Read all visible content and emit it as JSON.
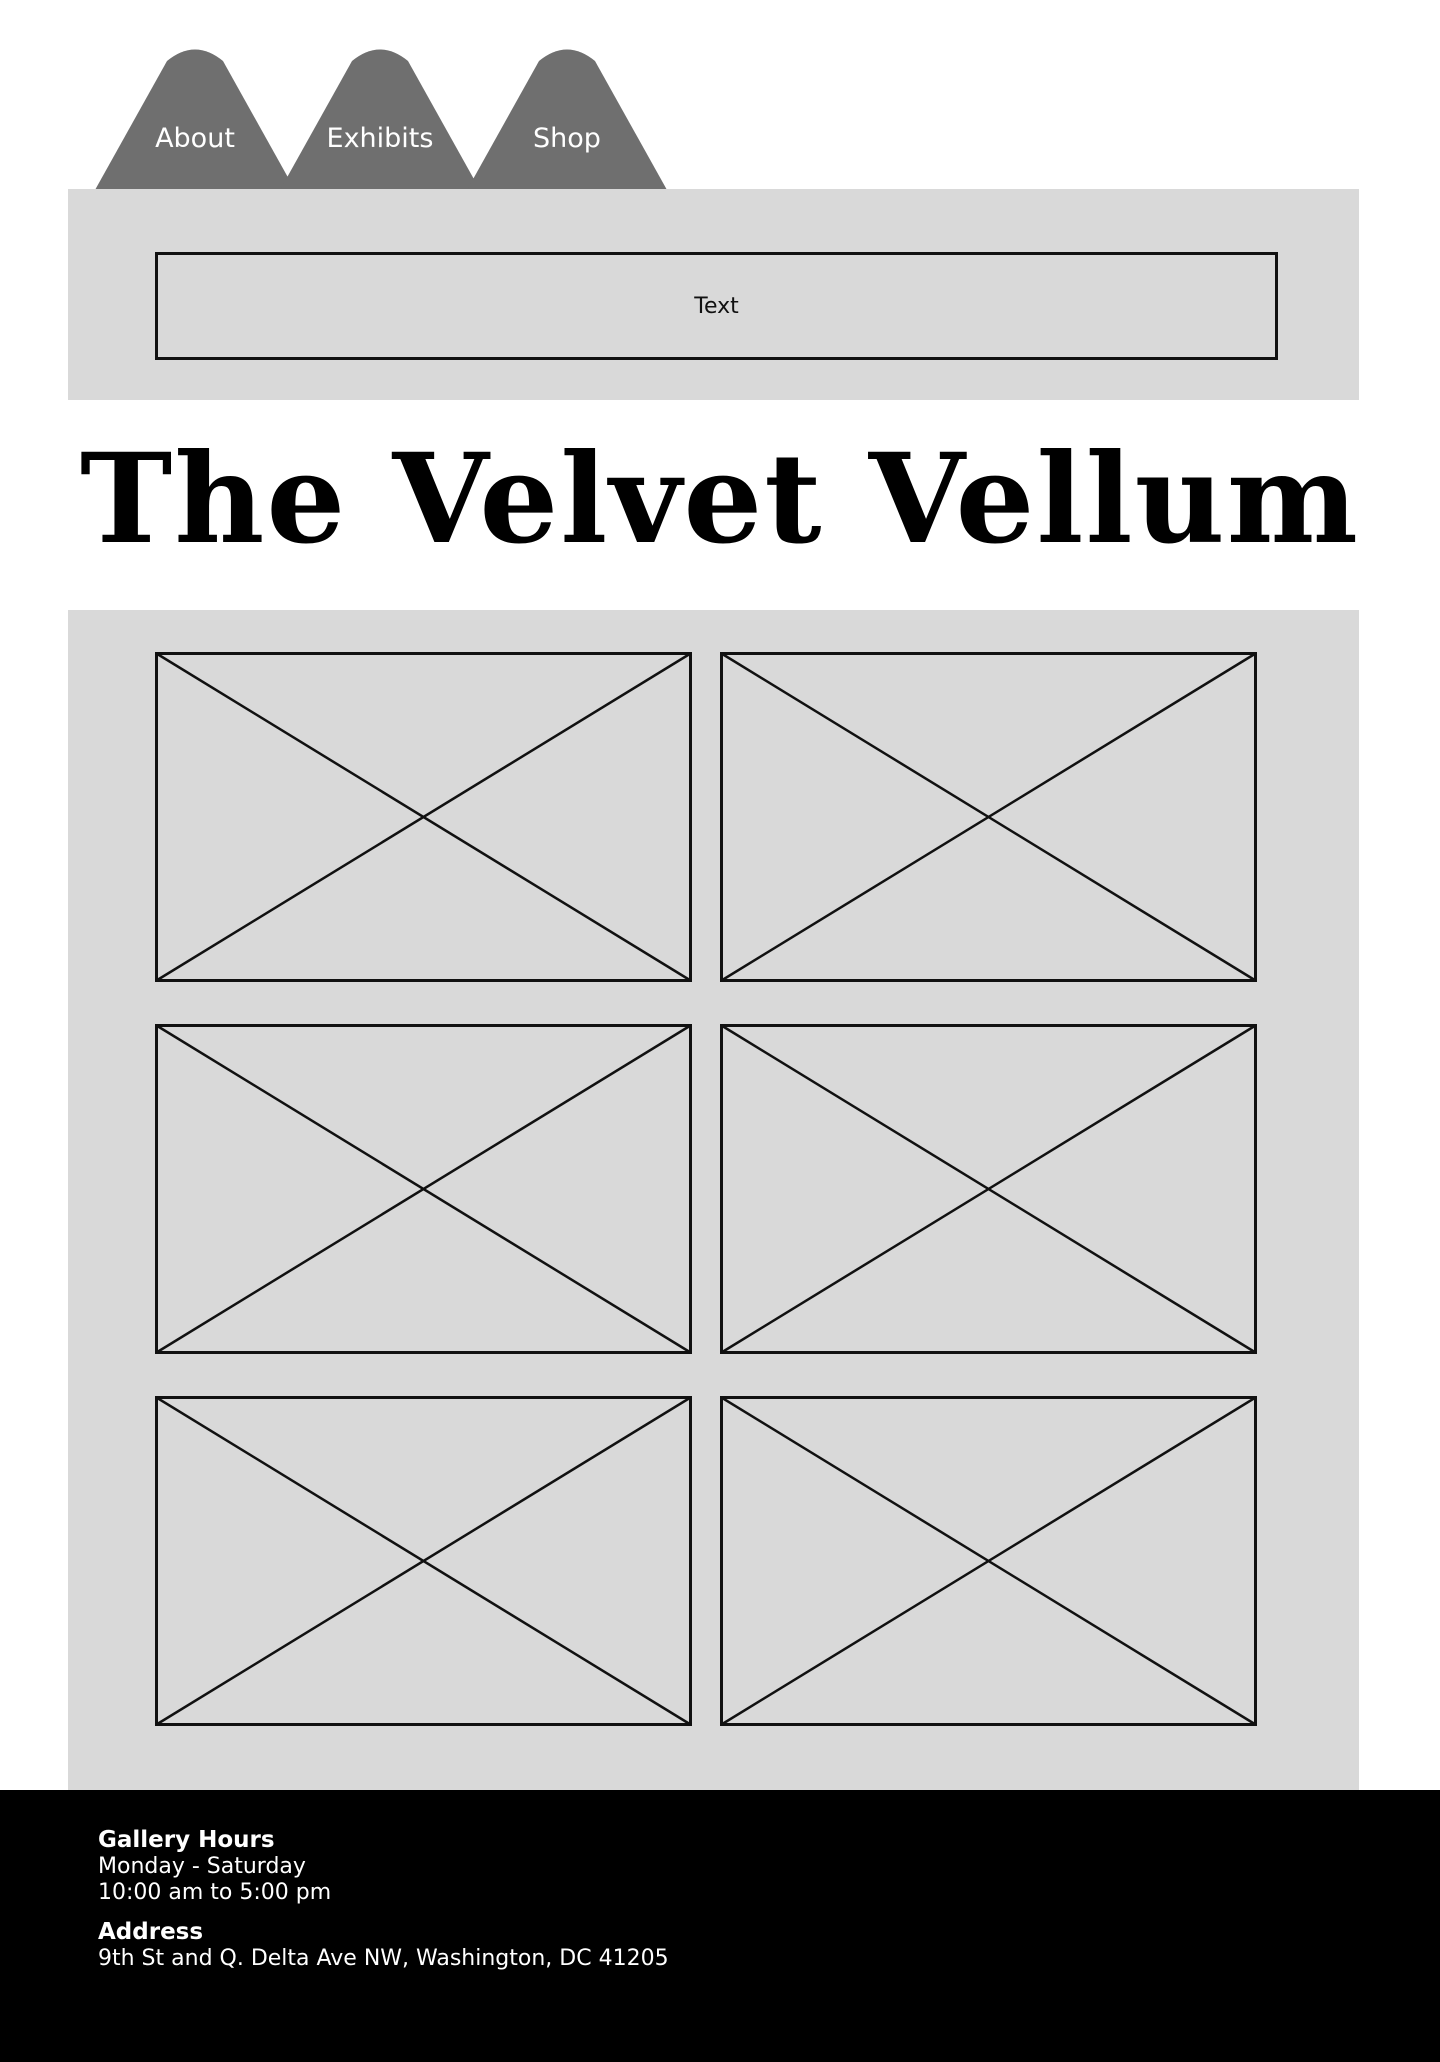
{
  "nav": {
    "tab_color": "#6f6f6f",
    "tabs": [
      {
        "label": "About"
      },
      {
        "label": "Exhibits"
      },
      {
        "label": "Shop"
      }
    ]
  },
  "top_panel": {
    "text_box_label": "Text"
  },
  "title": "The Velvet Vellum",
  "gallery": {
    "placeholder_count": 6,
    "panel_color": "#d9d9d9"
  },
  "footer": {
    "hours_heading": "Gallery Hours",
    "hours_days": "Monday - Saturday",
    "hours_time": "10:00 am to 5:00 pm",
    "address_heading": "Address",
    "address_line": "9th St and Q. Delta Ave NW, Washington, DC 41205"
  }
}
